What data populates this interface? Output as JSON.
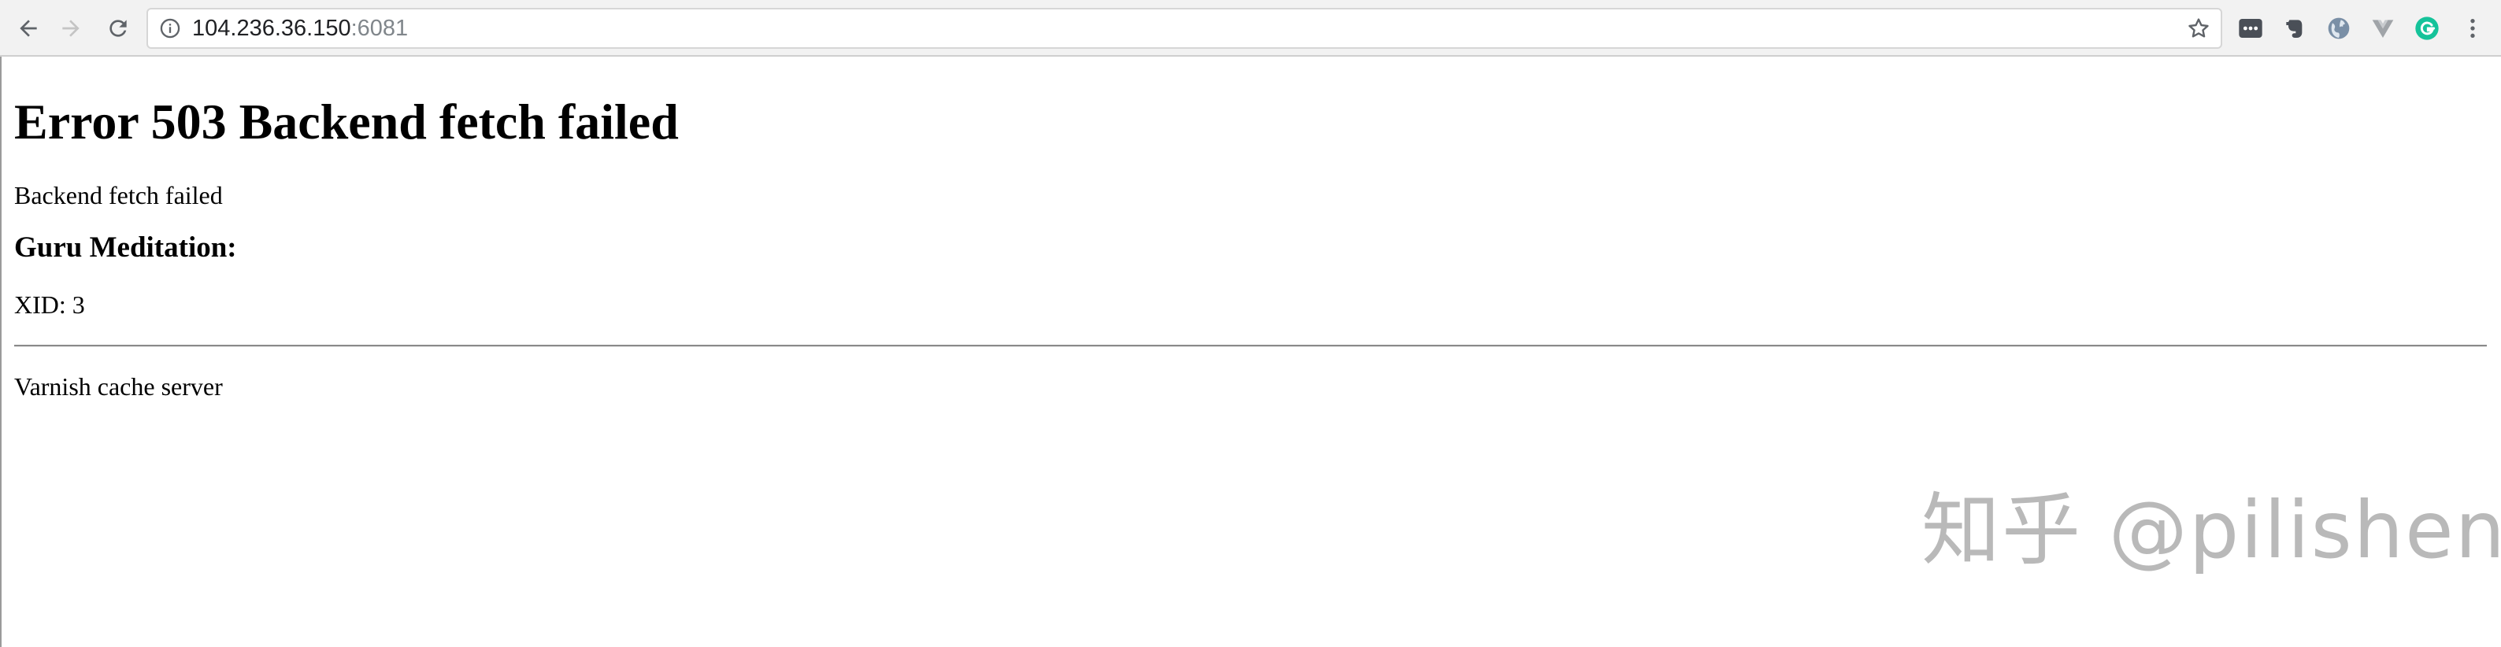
{
  "browser": {
    "url_host": "104.236.36.150",
    "url_port": ":6081",
    "icons": {
      "back": "back-arrow-icon",
      "forward": "forward-arrow-icon",
      "reload": "reload-icon",
      "site_info": "info-icon",
      "bookmark": "star-icon",
      "menu": "kebab-menu-icon"
    },
    "extensions": [
      {
        "name": "dots-extension-icon"
      },
      {
        "name": "evernote-icon"
      },
      {
        "name": "globe-extension-icon"
      },
      {
        "name": "vue-devtools-icon"
      },
      {
        "name": "grammarly-icon",
        "color": "#15c39a"
      }
    ]
  },
  "page": {
    "heading": "Error 503 Backend fetch failed",
    "message": "Backend fetch failed",
    "subheading": "Guru Meditation:",
    "xid": "XID: 3",
    "footer": "Varnish cache server"
  },
  "watermark": {
    "text": "知乎 @pilishen"
  }
}
